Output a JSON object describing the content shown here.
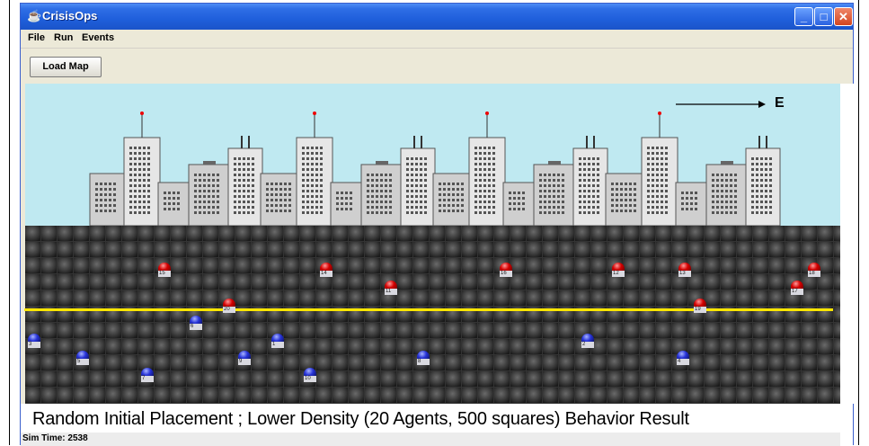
{
  "window": {
    "title": "CrisisOps",
    "icon": "coffee-cup-icon",
    "controls": {
      "minimize": "_",
      "maximize": "□",
      "close": "✕"
    }
  },
  "menu": [
    "File",
    "Run",
    "Events"
  ],
  "toolbar": {
    "load_map_label": "Load Map"
  },
  "scene": {
    "direction_label": "E",
    "boundary_line_color": "#ffe600",
    "sky_color": "#bfe9f1",
    "ground_color": "#333333"
  },
  "agents": {
    "red": [
      {
        "id": "15"
      },
      {
        "id": "14"
      },
      {
        "id": "16"
      },
      {
        "id": "12"
      },
      {
        "id": "13"
      },
      {
        "id": "18"
      },
      {
        "id": "11"
      },
      {
        "id": "17"
      },
      {
        "id": "20"
      },
      {
        "id": "19"
      }
    ],
    "blue": [
      {
        "id": "6"
      },
      {
        "id": "3"
      },
      {
        "id": "1"
      },
      {
        "id": "2"
      },
      {
        "id": "5"
      },
      {
        "id": "9"
      },
      {
        "id": "8"
      },
      {
        "id": "4"
      },
      {
        "id": "7"
      },
      {
        "id": "10"
      }
    ]
  },
  "caption": "Random Initial Placement ; Lower Density (20 Agents, 500 squares) Behavior Result",
  "status": {
    "sim_time": "Sim Time: 2538"
  }
}
